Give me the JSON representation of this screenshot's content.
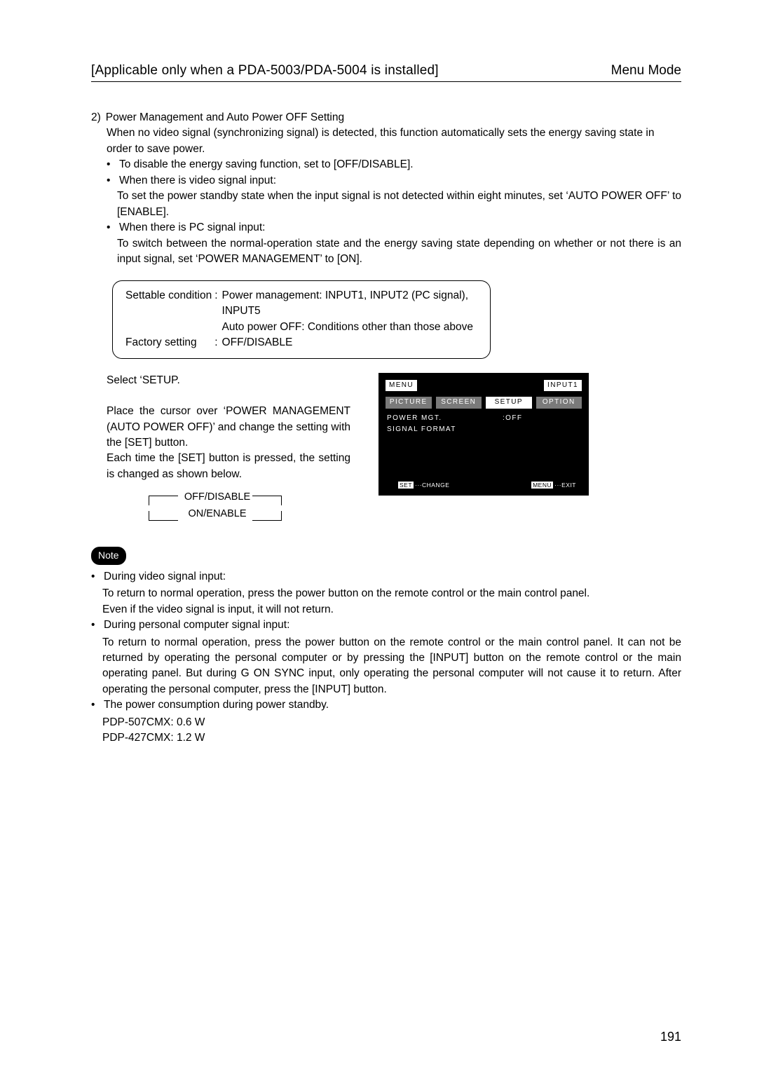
{
  "header": {
    "left": "[Applicable only when a PDA-5003/PDA-5004 is installed]",
    "right": "Menu Mode"
  },
  "section": {
    "number": "2)",
    "title": "Power Management and Auto Power OFF Setting",
    "intro": "When no video signal (synchronizing signal) is detected, this function automatically sets the energy saving state in order to save power.",
    "bullets": {
      "b1": "To disable the energy saving function, set to [OFF/DISABLE].",
      "b2_head": "When there is video signal input:",
      "b2_body": "To set the power standby state when the input signal is not detected within eight minutes, set  ‘AUTO POWER OFF’ to [ENABLE].",
      "b3_head": "When there is PC signal input:",
      "b3_body": "To switch between the normal-operation state and the energy saving state depending on whether or not there is an input signal, set ‘POWER MANAGEMENT’ to [ON]."
    }
  },
  "box": {
    "row1_label": "Settable condition",
    "row1_val_a": "Power management: INPUT1, INPUT2 (PC signal), INPUT5",
    "row1_val_b": "Auto power OFF: Conditions other than those above",
    "row2_label": "Factory setting",
    "row2_val": "OFF/DISABLE"
  },
  "instructions": {
    "p1": "Select ‘SETUP.",
    "p2": "Place the cursor over ‘POWER MANAGEMENT (AUTO POWER OFF)’ and change the setting with the [SET] button.",
    "p3": "Each time the [SET] button is pressed, the setting is changed as shown below.",
    "opt1": "OFF/DISABLE",
    "opt2": "ON/ENABLE"
  },
  "osd": {
    "menu": "MENU",
    "input": "INPUT1",
    "tabs": {
      "picture": "PICTURE",
      "screen": "SCREEN",
      "setup": "SETUP",
      "option": "OPTION"
    },
    "items": {
      "power_mgt_label": "POWER MGT.",
      "power_mgt_value": ":OFF",
      "signal_format": "SIGNAL FORMAT"
    },
    "footer": {
      "set": "SET",
      "change": "···CHANGE",
      "menu": "MENU",
      "exit": "···EXIT"
    }
  },
  "note": {
    "chip": "Note",
    "b1_head": "During video signal input:",
    "b1_l1": "To return to normal operation, press the power button on the remote control or the main control panel.",
    "b1_l2": "Even if the video signal is input, it will not return.",
    "b2_head": "During personal computer signal input:",
    "b2_body": "To return to normal operation, press the power button on the remote control or the main control panel. It can not be returned by operating the personal computer or by pressing the [INPUT] button on the remote control or the main operating panel. But during G ON SYNC input, only operating the personal computer will not cause it to return. After operating the personal computer, press the [INPUT] button.",
    "b3_head": "The power consumption during power standby.",
    "b3_l1": "PDP-507CMX: 0.6 W",
    "b3_l2": "PDP-427CMX: 1.2 W"
  },
  "page_number": "191"
}
